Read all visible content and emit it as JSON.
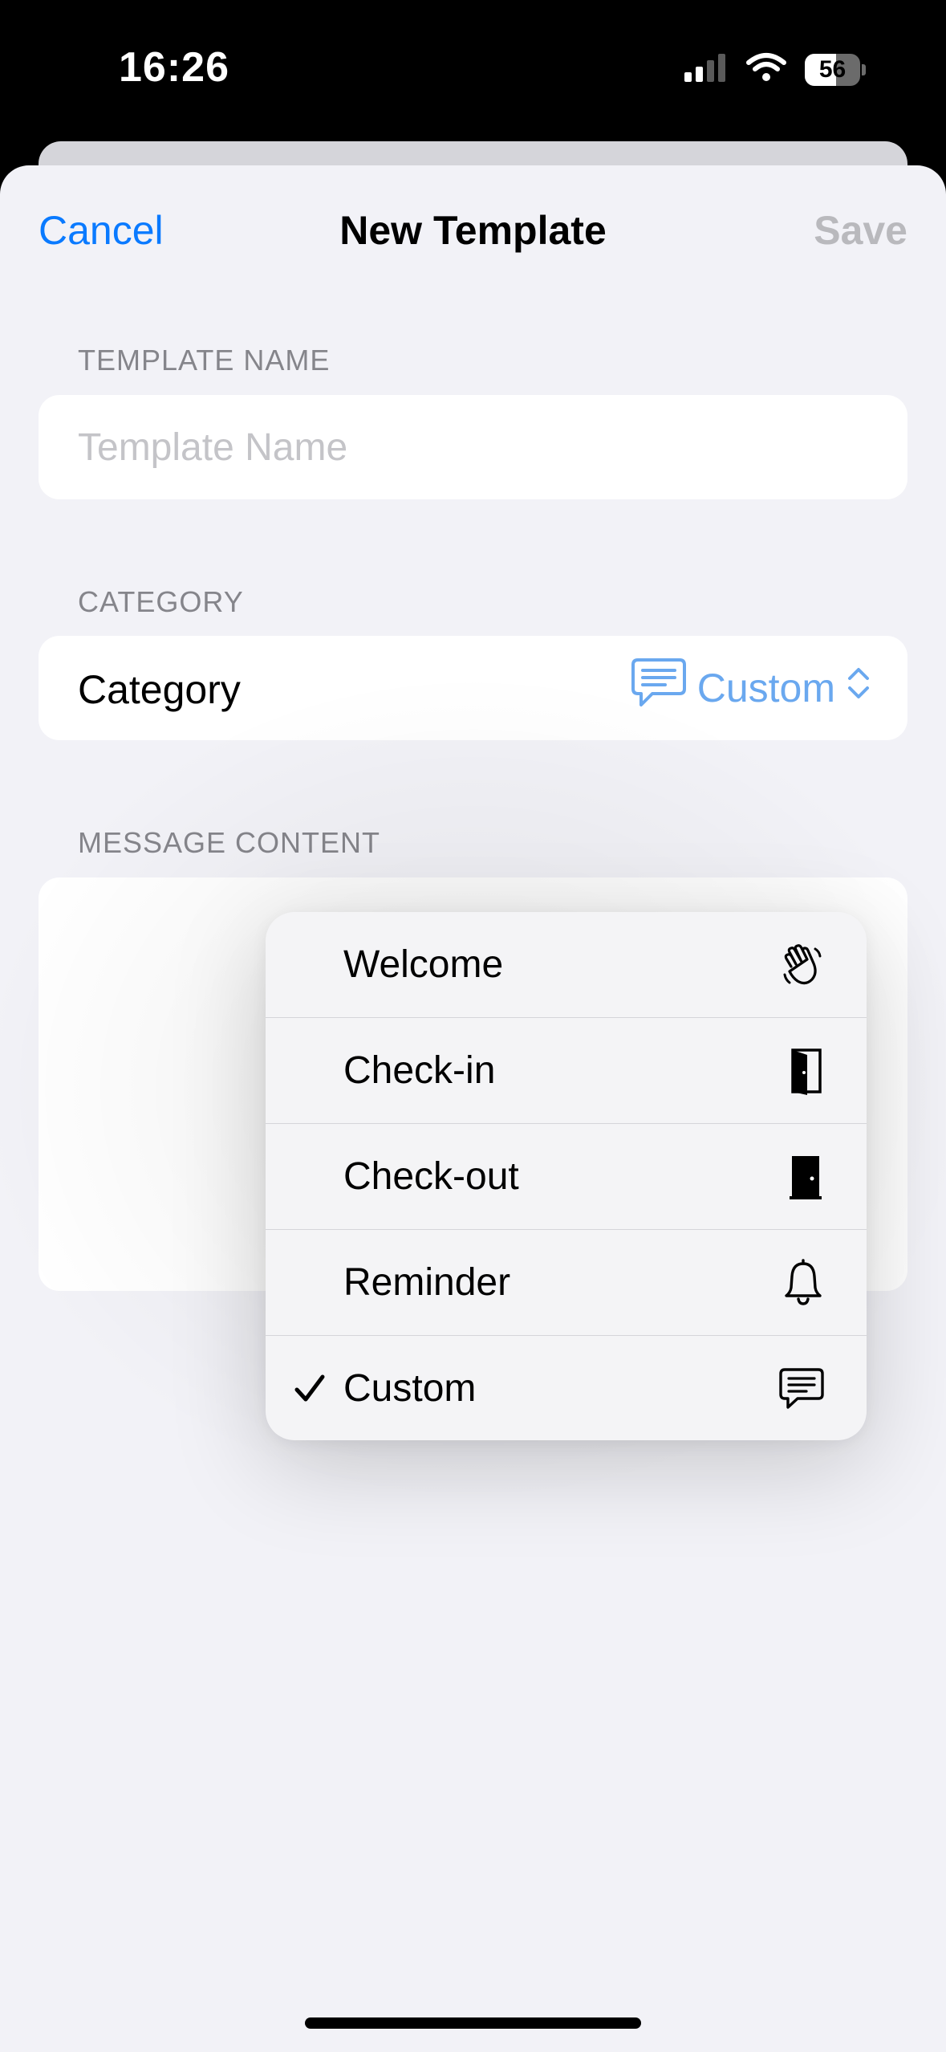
{
  "status_bar": {
    "time": "16:26",
    "battery_percent": "56",
    "battery_level": 0.56
  },
  "nav": {
    "cancel_label": "Cancel",
    "title": "New Template",
    "save_label": "Save"
  },
  "template_name_section": {
    "header": "TEMPLATE NAME",
    "placeholder": "Template Name",
    "value": ""
  },
  "category_section": {
    "header": "CATEGORY",
    "label": "Category",
    "selected_value": "Custom",
    "selected_icon": "speech-bubble-icon"
  },
  "message_section": {
    "header": "MESSAGE CONTENT"
  },
  "menu": {
    "items": [
      {
        "label": "Welcome",
        "icon": "waving-hand-icon",
        "selected": false
      },
      {
        "label": "Check-in",
        "icon": "door-open-icon",
        "selected": false
      },
      {
        "label": "Check-out",
        "icon": "door-closed-icon",
        "selected": false
      },
      {
        "label": "Reminder",
        "icon": "bell-icon",
        "selected": false
      },
      {
        "label": "Custom",
        "icon": "speech-bubble-icon",
        "selected": true
      }
    ]
  },
  "colors": {
    "accent": "#0a7aff",
    "picker_text": "#6aa8ef",
    "disabled": "#b9b9bd",
    "section_header": "#85858b",
    "background": "#f2f2f7"
  }
}
